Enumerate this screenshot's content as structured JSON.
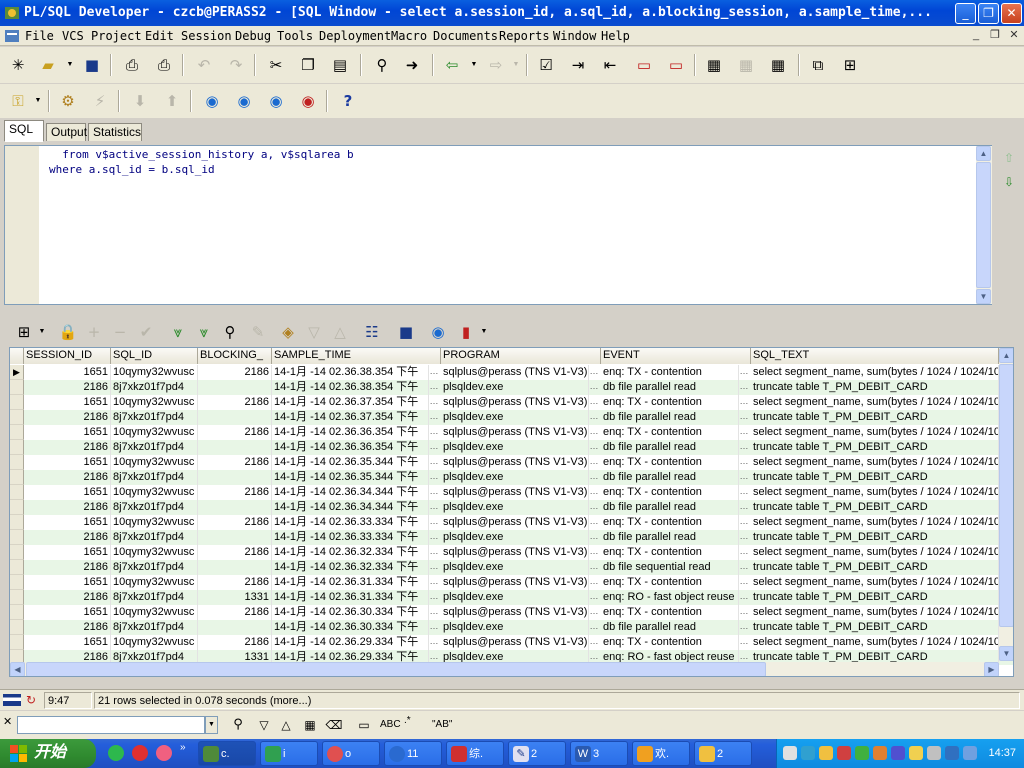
{
  "window": {
    "title": "PL/SQL Developer - czcb@PERASS2 - [SQL Window - select a.session_id, a.sql_id, a.blocking_session, a.sample_time,..."
  },
  "menu": [
    "File",
    "VCS",
    "Project",
    "Edit",
    "Session",
    "Debug",
    "Tools",
    "Deployment",
    "Macro",
    "Documents",
    "Reports",
    "Window",
    "Help"
  ],
  "tabs": [
    "SQL",
    "Output",
    "Statistics"
  ],
  "editor": {
    "lines": [
      "  from v$active_session_history a, v$sqlarea b",
      "where a.sql_id = b.sql_id"
    ]
  },
  "grid": {
    "columns": [
      "SESSION_ID",
      "SQL_ID",
      "BLOCKING_",
      "SAMPLE_TIME",
      "PROGRAM",
      "EVENT",
      "SQL_TEXT"
    ],
    "rows": [
      [
        "1651",
        "10qymy32wvusc",
        "2186",
        "14-1月 -14 02.36.38.354 下午",
        "sqlplus@perass (TNS V1-V3)",
        "enq: TX - contention",
        "select segment_name, sum(bytes / 1024 / 1024/10"
      ],
      [
        "2186",
        "8j7xkz01f7pd4",
        "",
        "14-1月 -14 02.36.38.354 下午",
        "plsqldev.exe",
        "db file parallel read",
        "truncate table T_PM_DEBIT_CARD"
      ],
      [
        "1651",
        "10qymy32wvusc",
        "2186",
        "14-1月 -14 02.36.37.354 下午",
        "sqlplus@perass (TNS V1-V3)",
        "enq: TX - contention",
        "select segment_name, sum(bytes / 1024 / 1024/10"
      ],
      [
        "2186",
        "8j7xkz01f7pd4",
        "",
        "14-1月 -14 02.36.37.354 下午",
        "plsqldev.exe",
        "db file parallel read",
        "truncate table T_PM_DEBIT_CARD"
      ],
      [
        "1651",
        "10qymy32wvusc",
        "2186",
        "14-1月 -14 02.36.36.354 下午",
        "sqlplus@perass (TNS V1-V3)",
        "enq: TX - contention",
        "select segment_name, sum(bytes / 1024 / 1024/10"
      ],
      [
        "2186",
        "8j7xkz01f7pd4",
        "",
        "14-1月 -14 02.36.36.354 下午",
        "plsqldev.exe",
        "db file parallel read",
        "truncate table T_PM_DEBIT_CARD"
      ],
      [
        "1651",
        "10qymy32wvusc",
        "2186",
        "14-1月 -14 02.36.35.344 下午",
        "sqlplus@perass (TNS V1-V3)",
        "enq: TX - contention",
        "select segment_name, sum(bytes / 1024 / 1024/10"
      ],
      [
        "2186",
        "8j7xkz01f7pd4",
        "",
        "14-1月 -14 02.36.35.344 下午",
        "plsqldev.exe",
        "db file parallel read",
        "truncate table T_PM_DEBIT_CARD"
      ],
      [
        "1651",
        "10qymy32wvusc",
        "2186",
        "14-1月 -14 02.36.34.344 下午",
        "sqlplus@perass (TNS V1-V3)",
        "enq: TX - contention",
        "select segment_name, sum(bytes / 1024 / 1024/10"
      ],
      [
        "2186",
        "8j7xkz01f7pd4",
        "",
        "14-1月 -14 02.36.34.344 下午",
        "plsqldev.exe",
        "db file parallel read",
        "truncate table T_PM_DEBIT_CARD"
      ],
      [
        "1651",
        "10qymy32wvusc",
        "2186",
        "14-1月 -14 02.36.33.334 下午",
        "sqlplus@perass (TNS V1-V3)",
        "enq: TX - contention",
        "select segment_name, sum(bytes / 1024 / 1024/10"
      ],
      [
        "2186",
        "8j7xkz01f7pd4",
        "",
        "14-1月 -14 02.36.33.334 下午",
        "plsqldev.exe",
        "db file parallel read",
        "truncate table T_PM_DEBIT_CARD"
      ],
      [
        "1651",
        "10qymy32wvusc",
        "2186",
        "14-1月 -14 02.36.32.334 下午",
        "sqlplus@perass (TNS V1-V3)",
        "enq: TX - contention",
        "select segment_name, sum(bytes / 1024 / 1024/10"
      ],
      [
        "2186",
        "8j7xkz01f7pd4",
        "",
        "14-1月 -14 02.36.32.334 下午",
        "plsqldev.exe",
        "db file sequential read",
        "truncate table T_PM_DEBIT_CARD"
      ],
      [
        "1651",
        "10qymy32wvusc",
        "2186",
        "14-1月 -14 02.36.31.334 下午",
        "sqlplus@perass (TNS V1-V3)",
        "enq: TX - contention",
        "select segment_name, sum(bytes / 1024 / 1024/10"
      ],
      [
        "2186",
        "8j7xkz01f7pd4",
        "1331",
        "14-1月 -14 02.36.31.334 下午",
        "plsqldev.exe",
        "enq: RO - fast object reuse",
        "truncate table T_PM_DEBIT_CARD"
      ],
      [
        "1651",
        "10qymy32wvusc",
        "2186",
        "14-1月 -14 02.36.30.334 下午",
        "sqlplus@perass (TNS V1-V3)",
        "enq: TX - contention",
        "select segment_name, sum(bytes / 1024 / 1024/10"
      ],
      [
        "2186",
        "8j7xkz01f7pd4",
        "",
        "14-1月 -14 02.36.30.334 下午",
        "plsqldev.exe",
        "db file parallel read",
        "truncate table T_PM_DEBIT_CARD"
      ],
      [
        "1651",
        "10qymy32wvusc",
        "2186",
        "14-1月 -14 02.36.29.334 下午",
        "sqlplus@perass (TNS V1-V3)",
        "enq: TX - contention",
        "select segment_name, sum(bytes / 1024 / 1024/10"
      ],
      [
        "2186",
        "8j7xkz01f7pd4",
        "1331",
        "14-1月 -14 02.36.29.334 下午",
        "plsqldev.exe",
        "enq: RO - fast object reuse",
        "truncate table T_PM_DEBIT_CARD"
      ]
    ]
  },
  "status": {
    "position": "9:47",
    "message": "21 rows selected in 0.078 seconds (more...)"
  },
  "find": {
    "value": "",
    "label_abc": "ABC",
    "label_ab": "\"AB\""
  },
  "taskbar": {
    "start": "开始",
    "tasks": [
      "c.",
      "i",
      "o",
      "11",
      "综.",
      "2",
      "3",
      "欢.",
      "2"
    ],
    "clock": "14:37"
  },
  "colors": {
    "row_alt": "#e8f6e6",
    "title_bar": "#0a5fe0",
    "start_green": "#3c9a3c"
  }
}
